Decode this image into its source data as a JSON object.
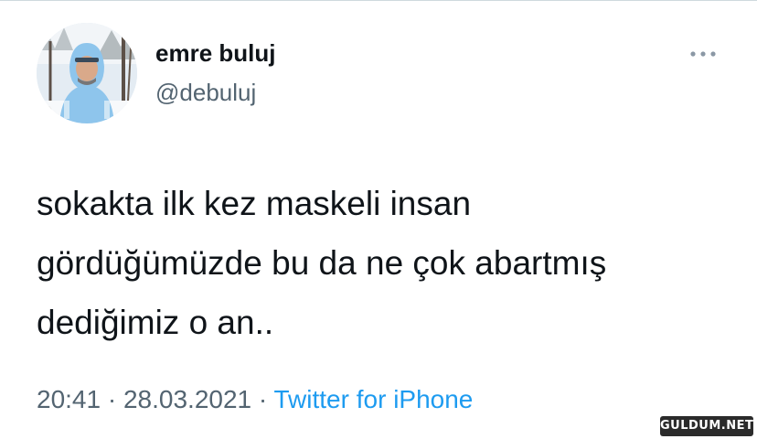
{
  "author": {
    "display_name": "emre buluj",
    "handle": "@debuluj"
  },
  "tweet": {
    "text_lines": [
      "sokakta ilk kez maskeli insan",
      "gördüğümüzde bu da ne çok abartmış",
      "dediğimiz o an.."
    ]
  },
  "meta": {
    "time": "20:41",
    "separator": " · ",
    "date": "28.03.2021",
    "source": "Twitter for iPhone"
  },
  "icons": {
    "more": "more-horizontal-icon"
  },
  "watermark": {
    "text": "GULDUM.NET"
  },
  "colors": {
    "text": "#0f1419",
    "secondary": "#536471",
    "link": "#1d9bf0",
    "avatar_jacket": "#8ec5ec"
  }
}
